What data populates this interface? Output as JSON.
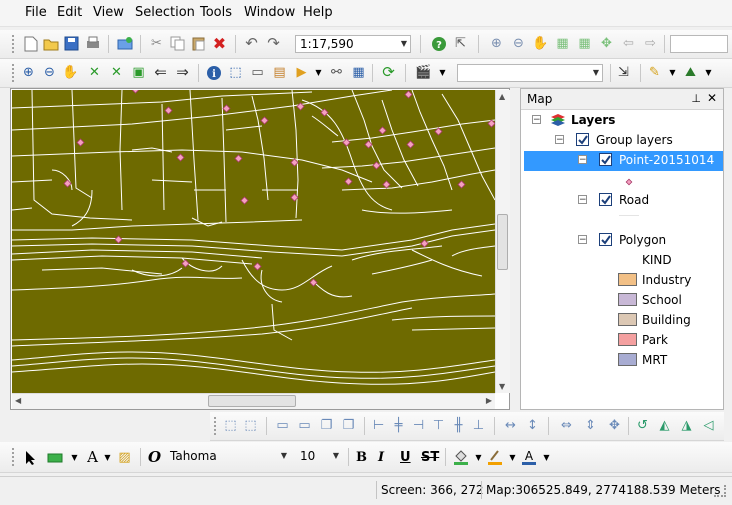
{
  "menu": [
    "File",
    "Edit",
    "View",
    "Selection",
    "Tools",
    "Window",
    "Help"
  ],
  "toolbar": {
    "scale_value": "1:17,590"
  },
  "format_toolbar": {
    "font_name": "Tahoma",
    "font_size": "10",
    "bold": "B",
    "italic": "I",
    "underline": "U",
    "strikethrough": "ST"
  },
  "panel": {
    "title": "Map",
    "root_label": "Layers",
    "group_label": "Group layers",
    "layers": [
      {
        "label": "Point-20151014",
        "checked": true,
        "selected": true
      },
      {
        "label": "Road",
        "checked": true,
        "selected": false
      },
      {
        "label": "Polygon",
        "checked": true,
        "selected": false
      }
    ],
    "legend_field": "KIND",
    "legend": [
      {
        "label": "Industry",
        "color": "#f2c086"
      },
      {
        "label": "School",
        "color": "#c8b8d6"
      },
      {
        "label": "Building",
        "color": "#dcc8b4"
      },
      {
        "label": "Park",
        "color": "#f4a0a0"
      },
      {
        "label": "MRT",
        "color": "#a8acd2"
      }
    ]
  },
  "map": {
    "background_color": "#6e6a00",
    "road_color": "#ffffff",
    "point_color": "#f4a0c0"
  },
  "status": {
    "screen": "Screen: 366, 272",
    "map_coords": "Map:306525.849, 2774188.539 Meters"
  }
}
